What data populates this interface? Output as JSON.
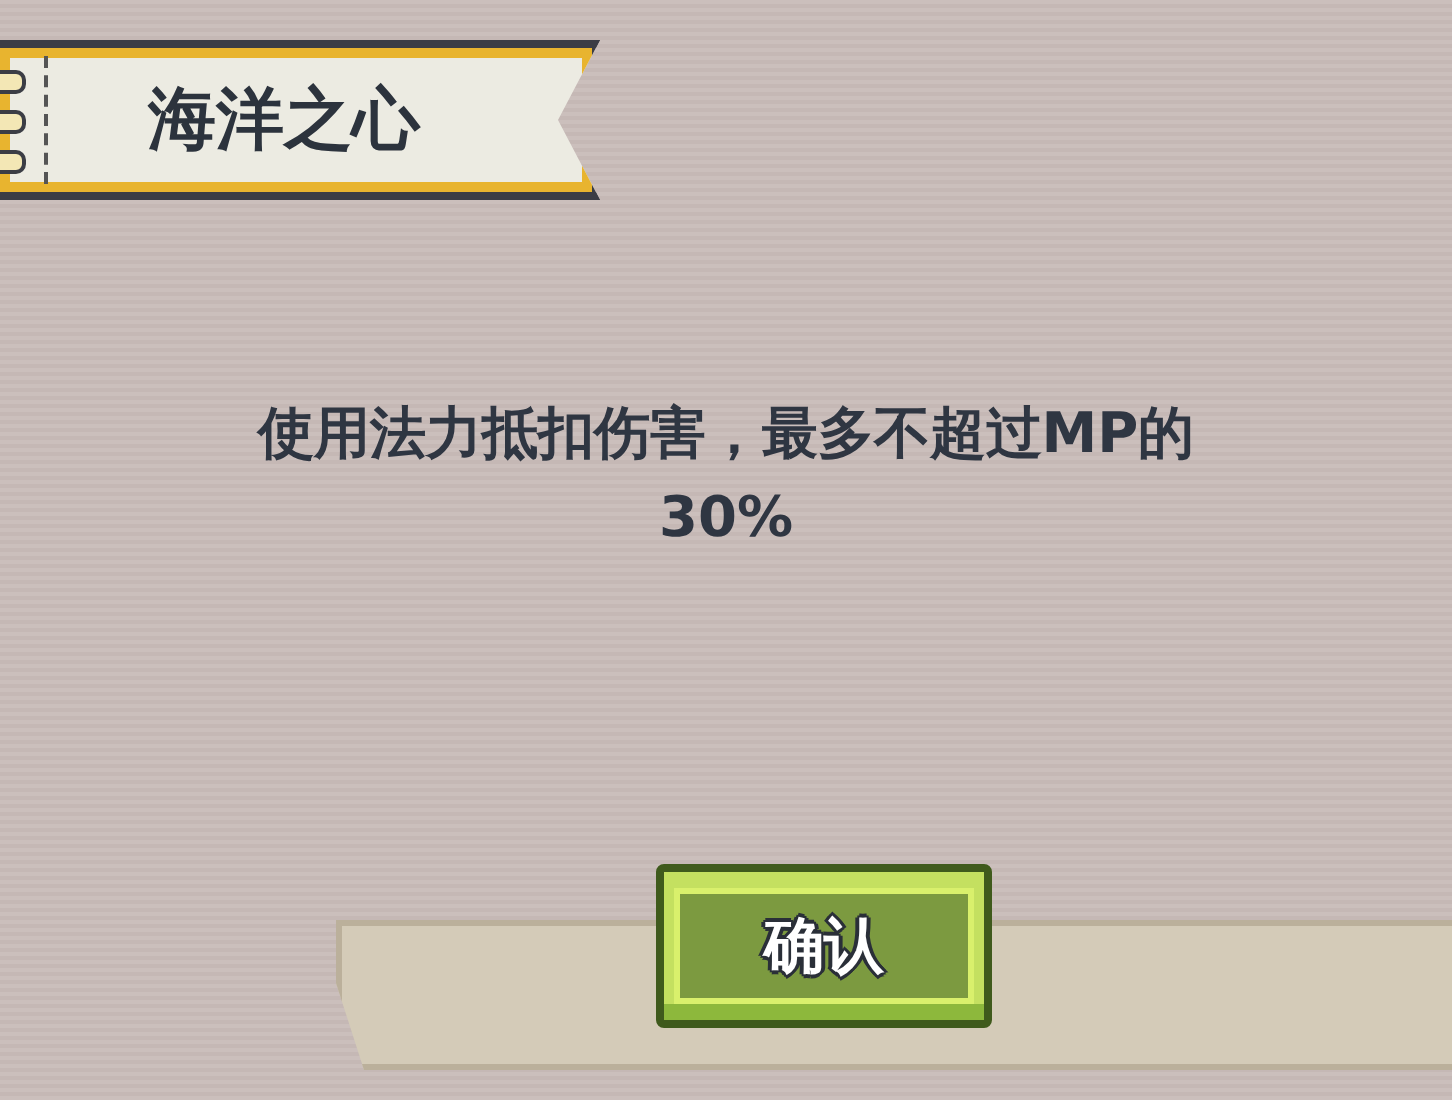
{
  "title": "海洋之心",
  "message": [
    "使用法力抵扣伤害，最多不超过MP的",
    "30%"
  ],
  "buttons": [
    "确认"
  ]
}
